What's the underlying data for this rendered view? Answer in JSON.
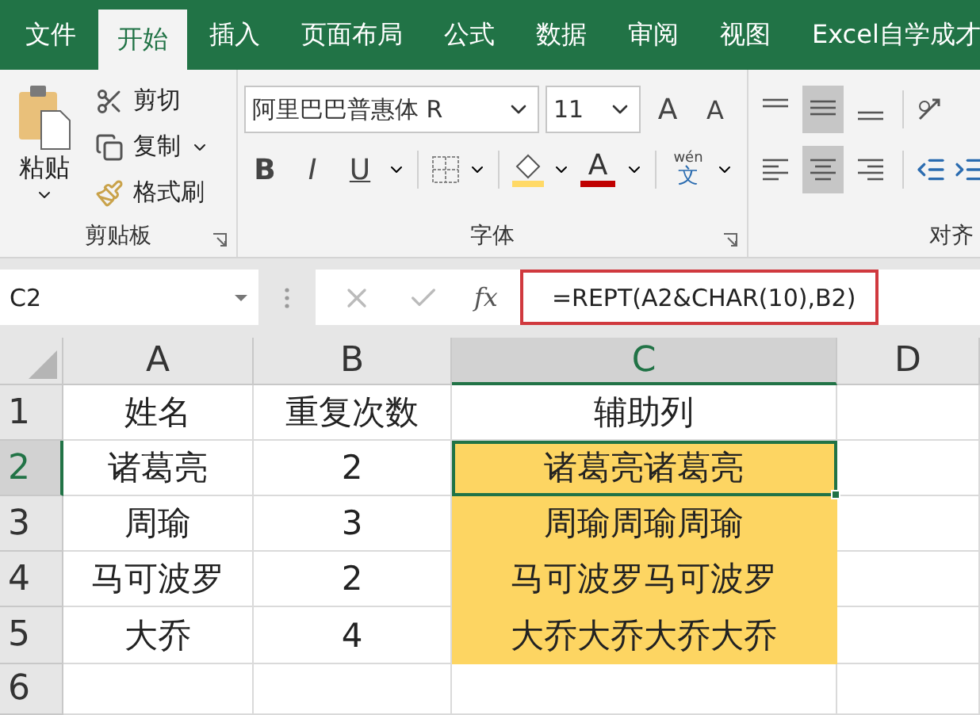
{
  "tabs": [
    {
      "label": "文件",
      "selected": false
    },
    {
      "label": "开始",
      "selected": true
    },
    {
      "label": "插入",
      "selected": false
    },
    {
      "label": "页面布局",
      "selected": false
    },
    {
      "label": "公式",
      "selected": false
    },
    {
      "label": "数据",
      "selected": false
    },
    {
      "label": "审阅",
      "selected": false
    },
    {
      "label": "视图",
      "selected": false
    },
    {
      "label": "Excel自学成才",
      "selected": false
    }
  ],
  "ribbon": {
    "clipboard": {
      "paste": "粘贴",
      "cut": "剪切",
      "copy": "复制",
      "format_painter": "格式刷",
      "label": "剪贴板"
    },
    "font": {
      "font_name": "阿里巴巴普惠体 R",
      "font_size": "11",
      "grow": "A",
      "shrink": "A",
      "bold": "B",
      "italic": "I",
      "underline": "U",
      "font_color": "A",
      "phonetic_top": "wén",
      "phonetic_bottom": "文",
      "label": "字体"
    },
    "alignment": {
      "label": "对齐",
      "vertical": [
        {
          "selected": false
        },
        {
          "selected": true
        },
        {
          "selected": false
        }
      ],
      "horizontal": [
        {
          "selected": false
        },
        {
          "selected": true
        },
        {
          "selected": false
        }
      ]
    }
  },
  "formula_bar": {
    "name_box": "C2",
    "function_label": "fx",
    "formula": "=REPT(A2&CHAR(10),B2)",
    "highlighted": true
  },
  "sheet": {
    "columns": [
      {
        "label": "A",
        "selected": false
      },
      {
        "label": "B",
        "selected": false
      },
      {
        "label": "C",
        "selected": true
      },
      {
        "label": "D",
        "selected": false
      }
    ],
    "rows": [
      {
        "label": "1",
        "selected": false,
        "cells": [
          {
            "text": "姓名"
          },
          {
            "text": "重复次数"
          },
          {
            "text": "辅助列"
          }
        ]
      },
      {
        "label": "2",
        "selected": true,
        "cells": [
          {
            "text": "诸葛亮"
          },
          {
            "text": "2"
          },
          {
            "text": "诸葛亮诸葛亮",
            "highlighted": true,
            "selected": true
          }
        ]
      },
      {
        "label": "3",
        "selected": false,
        "cells": [
          {
            "text": "周瑜"
          },
          {
            "text": "3"
          },
          {
            "text": "周瑜周瑜周瑜",
            "highlighted": true
          }
        ]
      },
      {
        "label": "4",
        "selected": false,
        "cells": [
          {
            "text": "马可波罗"
          },
          {
            "text": "2"
          },
          {
            "text": "马可波罗马可波罗",
            "highlighted": true
          }
        ]
      },
      {
        "label": "5",
        "selected": false,
        "cells": [
          {
            "text": "大乔"
          },
          {
            "text": "4"
          },
          {
            "text": "大乔大乔大乔大乔",
            "highlighted": true
          }
        ]
      },
      {
        "label": "6",
        "selected": false
      }
    ]
  }
}
